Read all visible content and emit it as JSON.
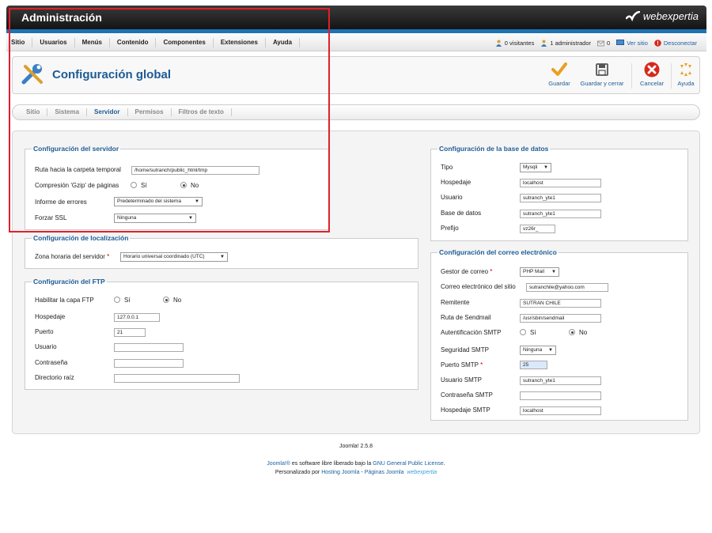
{
  "header": {
    "title": "Administración",
    "brand": "webexpertia"
  },
  "menu": [
    "Sitio",
    "Usuarios",
    "Menús",
    "Contenido",
    "Componentes",
    "Extensiones",
    "Ayuda"
  ],
  "status": {
    "visitors": "0 visitantes",
    "admins": "1 administrador",
    "messages": "0",
    "view_site": "Ver sitio",
    "logout": "Desconectar"
  },
  "toolbar": {
    "page_title": "Configuración global",
    "save": "Guardar",
    "save_close": "Guardar y cerrar",
    "cancel": "Cancelar",
    "help": "Ayuda"
  },
  "tabs": [
    "Sitio",
    "Sistema",
    "Servidor",
    "Permisos",
    "Filtros de texto"
  ],
  "server": {
    "legend": "Configuración del servidor",
    "tmp_label": "Ruta hacia la carpeta temporal",
    "tmp_value": "/home/sutranch/public_html/tmp",
    "gzip_label": "Compresión 'Gzip' de páginas",
    "yes": "Sí",
    "no": "No",
    "errors_label": "Informe de errores",
    "errors_value": "Predeterminado del sistema",
    "ssl_label": "Forzar SSL",
    "ssl_value": "Ninguna"
  },
  "locale": {
    "legend": "Configuración de localización",
    "tz_label": "Zona horaria del servidor",
    "tz_value": "Horario universal coordinado (UTC)"
  },
  "ftp": {
    "legend": "Configuración del FTP",
    "enable_label": "Habilitar la capa FTP",
    "yes": "Sí",
    "no": "No",
    "host_label": "Hospedaje",
    "host_value": "127.0.0.1",
    "port_label": "Puerto",
    "port_value": "21",
    "user_label": "Usuario",
    "user_value": "",
    "pass_label": "Contraseña",
    "pass_value": "",
    "root_label": "Directorio raíz",
    "root_value": ""
  },
  "db": {
    "legend": "Configuración de la base de datos",
    "type_label": "Tipo",
    "type_value": "Mysqli",
    "host_label": "Hospedaje",
    "host_value": "localhost",
    "user_label": "Usuario",
    "user_value": "sutranch_yte1",
    "name_label": "Base de datos",
    "name_value": "sutranch_yte1",
    "prefix_label": "Prefijo",
    "prefix_value": "vz26r_"
  },
  "mail": {
    "legend": "Configuración del correo electrónico",
    "mailer_label": "Gestor de correo",
    "mailer_value": "PHP Mail",
    "from_label": "Correo electrónico del sitio",
    "from_value": "sutranchile@yahoo.com",
    "sender_label": "Remitente",
    "sender_value": "SUTRAN CHILE",
    "sendmail_label": "Ruta de Sendmail",
    "sendmail_value": "/usr/sbin/sendmail",
    "smtpauth_label": "Autentificación SMTP",
    "yes": "Sí",
    "no": "No",
    "secure_label": "Seguridad SMTP",
    "secure_value": "Ninguna",
    "port_label": "Puerto SMTP",
    "port_value": "25",
    "smtpuser_label": "Usuario SMTP",
    "smtpuser_value": "sutranch_yte1",
    "smtppass_label": "Contraseña SMTP",
    "smtppass_value": "",
    "smtphost_label": "Hospedaje SMTP",
    "smtphost_value": "localhost"
  },
  "footer": {
    "version": "Joomla! 2.5.8",
    "joomla": "Joomla!®",
    "license_text": " es software libre liberado bajo la ",
    "license_link": "GNU General Public License",
    "custom_text": "Personalizado por ",
    "hosting_link": "Hosting Joomla",
    "dash": " - ",
    "pages_link": "Páginas Joomla",
    "brand": "webexpertia"
  },
  "colors": {
    "accent": "#1d5b94",
    "topbar": "#1e73b5",
    "highlight": "#e0202a"
  }
}
